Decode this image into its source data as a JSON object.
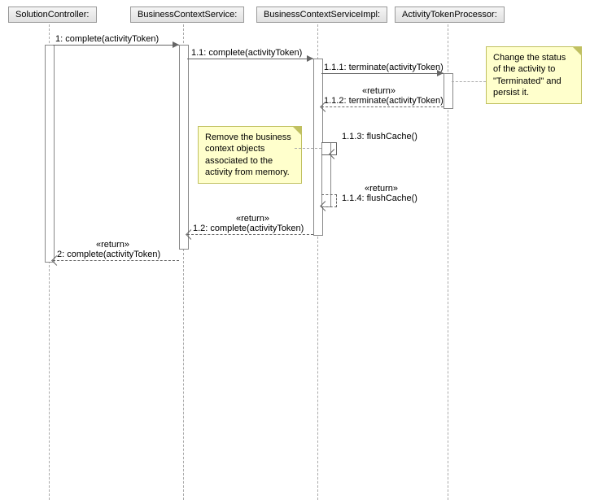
{
  "lifelines": {
    "l1": "SolutionController:",
    "l2": "BusinessContextService:",
    "l3": "BusinessContextServiceImpl:",
    "l4": "ActivityTokenProcessor:"
  },
  "messages": {
    "m1": "1: complete(activityToken)",
    "m11": "1.1: complete(activityToken)",
    "m111": "1.1.1: terminate(activityToken)",
    "r111": "«return»",
    "m112": "1.1.2: terminate(activityToken)",
    "m113": "1.1.3: flushCache()",
    "r113": "«return»",
    "m114": "1.1.4: flushCache()",
    "r11": "«return»",
    "m12": "1.2: complete(activityToken)",
    "r1": "«return»",
    "m2": "2: complete(activityToken)"
  },
  "notes": {
    "n1": "Change the status of the activity to \"Terminated\" and persist it.",
    "n2": "Remove the business context objects associated to the activity from memory."
  }
}
